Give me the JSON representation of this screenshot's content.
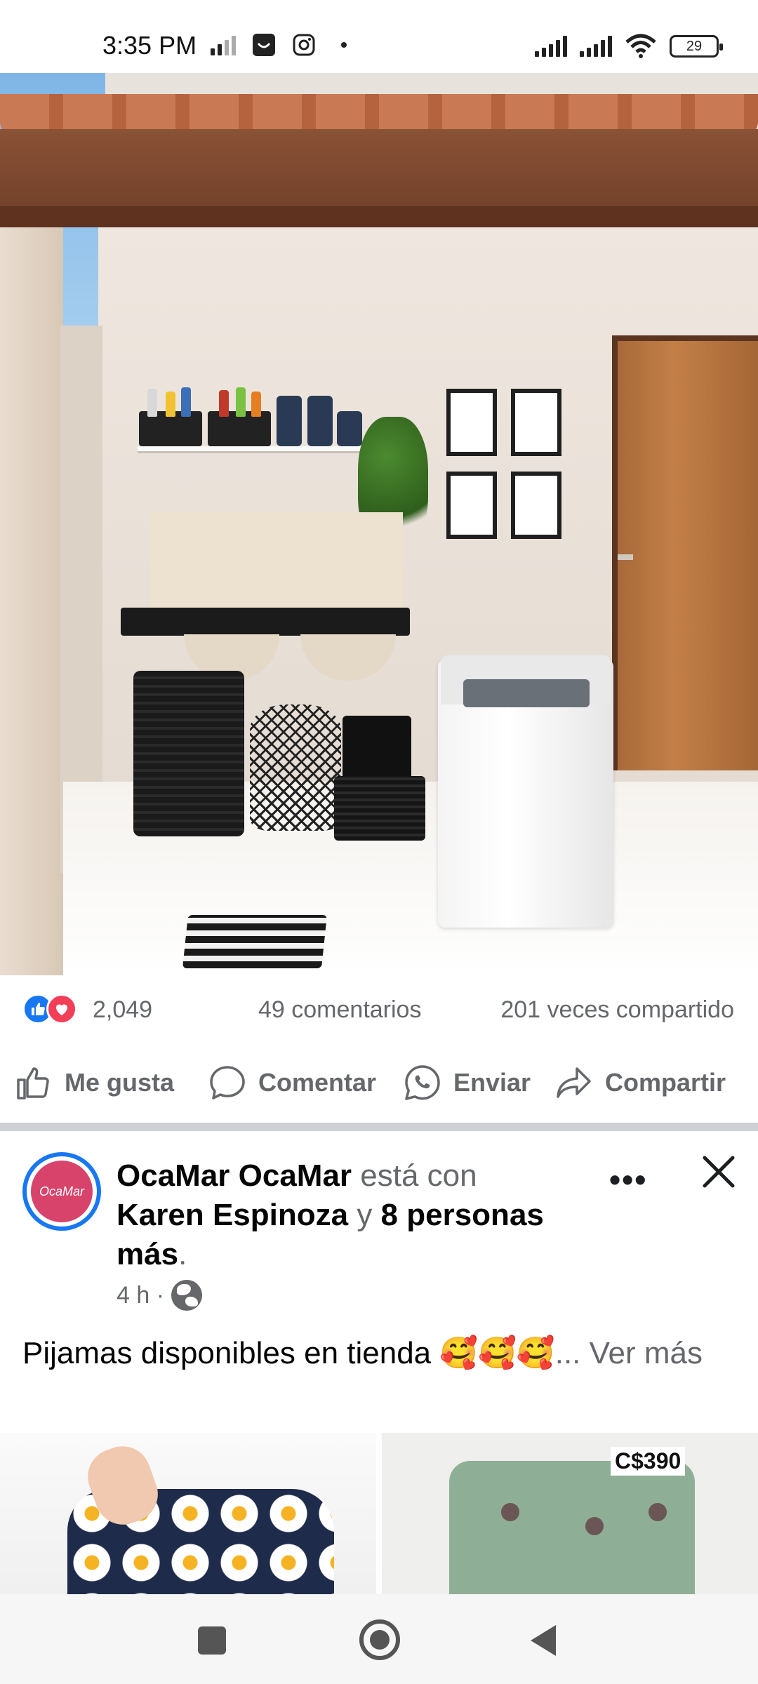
{
  "status_bar": {
    "time": "3:35 PM",
    "battery": "29"
  },
  "post1": {
    "reactions_count": "2,049",
    "comments": "49 comentarios",
    "shares": "201 veces compartido",
    "actions": {
      "like": "Me gusta",
      "comment": "Comentar",
      "send": "Enviar",
      "share": "Compartir"
    }
  },
  "post2": {
    "author": "OcaMar OcaMar",
    "with_text": " está con ",
    "tagged_person": "Karen Espinoza",
    "and_text": " y ",
    "others": "8 personas más",
    "period": ".",
    "time": "4 h ·",
    "text": "Pijamas disponibles en tienda 🥰🥰🥰",
    "see_more": "... Ver más",
    "price_tag": "C$390",
    "avatar_text": "OcaMar"
  },
  "colors": {
    "facebook_blue": "#1877f2",
    "love_red": "#f33e58",
    "muted_text": "#65676b"
  }
}
